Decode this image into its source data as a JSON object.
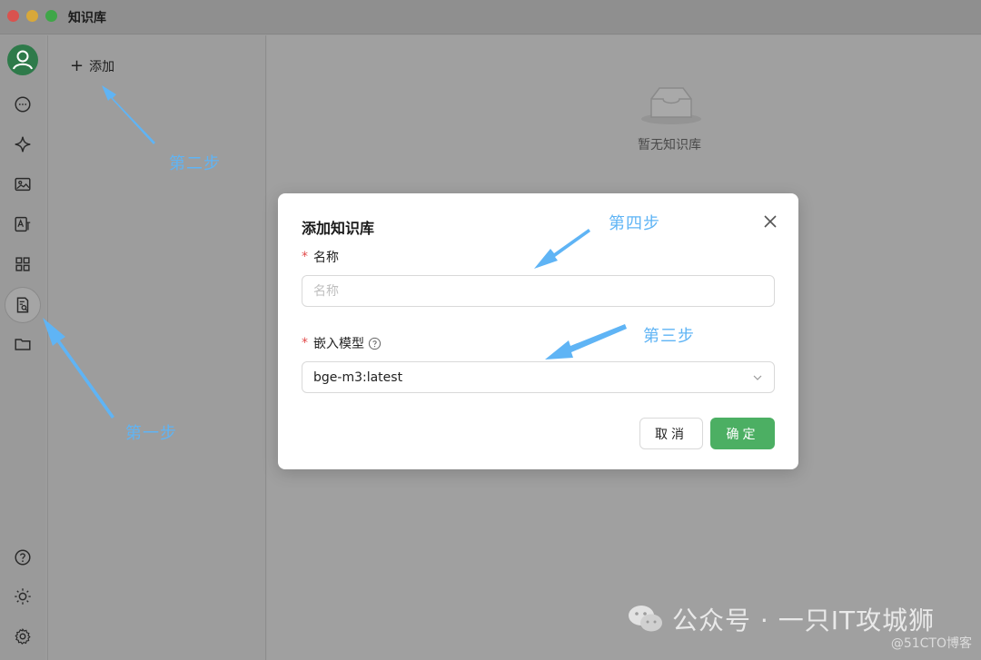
{
  "window": {
    "title": "知识库"
  },
  "sidebar": {
    "items": [
      {
        "name": "chat",
        "icon": "chat-bubble-icon"
      },
      {
        "name": "assistant",
        "icon": "sparkle-icon"
      },
      {
        "name": "image",
        "icon": "image-icon"
      },
      {
        "name": "translate",
        "icon": "translate-icon"
      },
      {
        "name": "apps",
        "icon": "grid-icon"
      },
      {
        "name": "knowledge",
        "icon": "knowledge-search-icon",
        "active": true
      },
      {
        "name": "files",
        "icon": "folder-icon"
      }
    ],
    "bottom": [
      {
        "name": "help",
        "icon": "help-icon"
      },
      {
        "name": "theme",
        "icon": "sun-icon"
      },
      {
        "name": "settings",
        "icon": "gear-icon"
      }
    ]
  },
  "list_pane": {
    "add_label": "添加"
  },
  "main": {
    "empty_text": "暂无知识库"
  },
  "dialog": {
    "title": "添加知识库",
    "name_label": "名称",
    "name_placeholder": "名称",
    "name_value": "",
    "model_label": "嵌入模型",
    "model_value": "bge-m3:latest",
    "cancel_label": "取消",
    "ok_label": "确定"
  },
  "annotations": {
    "step1": "第一步",
    "step2": "第二步",
    "step3": "第三步",
    "step4": "第四步"
  },
  "watermark": {
    "main": "公众号 · 一只IT攻城狮",
    "site": "@51CTO博客"
  },
  "colors": {
    "accent_green": "#4caf63",
    "annotation_blue": "#5fb4f5",
    "required_red": "#e24b4b"
  }
}
